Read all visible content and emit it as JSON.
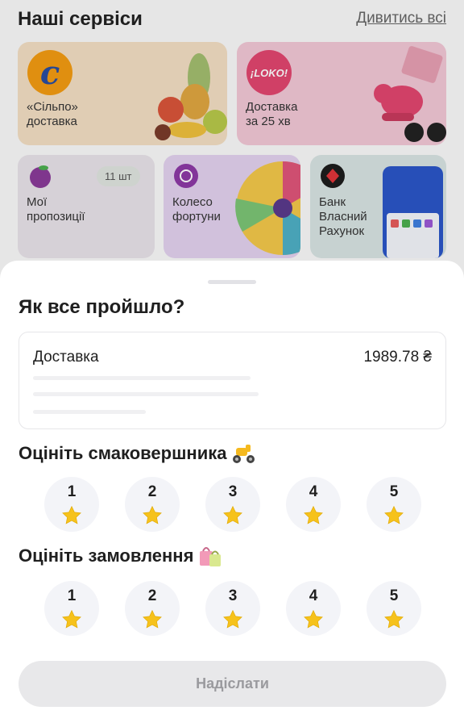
{
  "background": {
    "title": "Наші сервіси",
    "see_all": "Дивитись всі",
    "cards": {
      "silpo": {
        "label": "«Сільпо»\nдоставка",
        "logo": "c"
      },
      "loko": {
        "label": "Доставка\nза 25 хв",
        "logo": "¡LOKO!"
      },
      "offers": {
        "label": "Мої\nпропозиції",
        "badge": "11 шт"
      },
      "wheel": {
        "label": "Колесо\nфортуни"
      },
      "bank": {
        "label": "Банк\nВласний\nРахунок"
      }
    }
  },
  "sheet": {
    "title": "Як все пройшло?",
    "order": {
      "label": "Доставка",
      "amount": "1989.78 ₴"
    },
    "courier_rating": {
      "title": "Оцініть смаковершника",
      "icon": "scooter-emoji",
      "options": [
        "1",
        "2",
        "3",
        "4",
        "5"
      ]
    },
    "order_rating": {
      "title": "Оцініть замовлення",
      "icon": "shopping-bags-emoji",
      "options": [
        "1",
        "2",
        "3",
        "4",
        "5"
      ]
    },
    "submit_label": "Надіслати"
  },
  "colors": {
    "star": "#f6c21c",
    "button_bg": "#e8e8ea",
    "button_text": "#9a9a9e"
  }
}
